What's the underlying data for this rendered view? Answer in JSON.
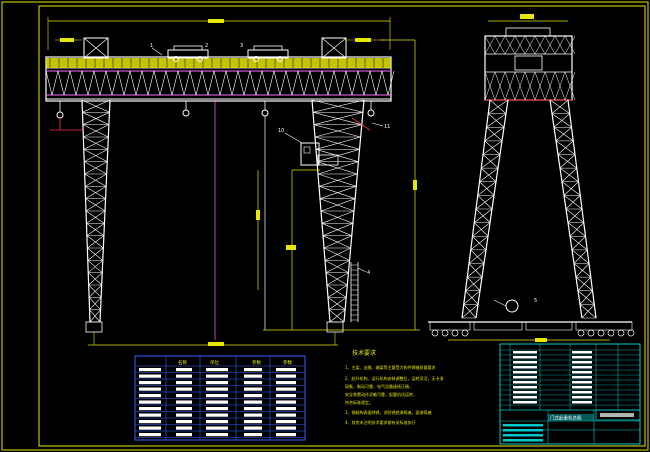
{
  "drawing": {
    "tech_notes_title": "技术要求",
    "callouts": [
      "1",
      "2",
      "3",
      "10",
      "11",
      "4",
      "5"
    ],
    "tech_notes_lines": [
      "1、主梁、支腿、端梁等主要受力构件焊缝质量要求",
      "2、起升机构、运行机构安装调整后，运转灵活，无卡滞",
      "   现象，制动可靠，电气设备接线正确，",
      "   安全装置动作灵敏可靠，起重机试运转，",
      "   符合标准规定。",
      "3、钢结构表面除锈，涂防锈底漆两遍，面漆两遍",
      "4、其余未注明技术要求按有关标准执行"
    ],
    "parameter_table_headers": [
      "名称",
      "单位",
      "参数",
      "参数"
    ],
    "title_block_name": "门式起重机总图"
  },
  "colors": {
    "background": "#000000",
    "frame": "#e6e600",
    "structure": "#ffffff",
    "girder_trim": "#ff66ff",
    "table_lines": "#3060ff",
    "title_block": "#00c8c8",
    "text": "#ffff00"
  }
}
